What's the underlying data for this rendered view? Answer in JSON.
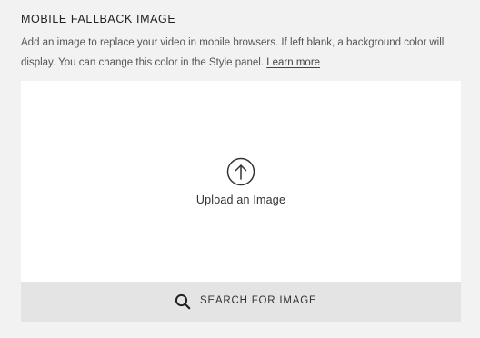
{
  "section": {
    "title": "MOBILE FALLBACK IMAGE",
    "description_line1": "Add an image to replace your video in mobile browsers. If left blank, a background color will",
    "description_line2": "display. You can change this color in the Style panel.",
    "learn_more_link": "Learn more"
  },
  "upload": {
    "icon": "upload-arrow-icon",
    "label": "Upload an Image"
  },
  "search": {
    "icon": "search-icon",
    "label": "SEARCH FOR IMAGE"
  },
  "colors": {
    "background": "#f2f2f2",
    "upload_area": "#ffffff",
    "search_button": "#e4e4e4"
  }
}
